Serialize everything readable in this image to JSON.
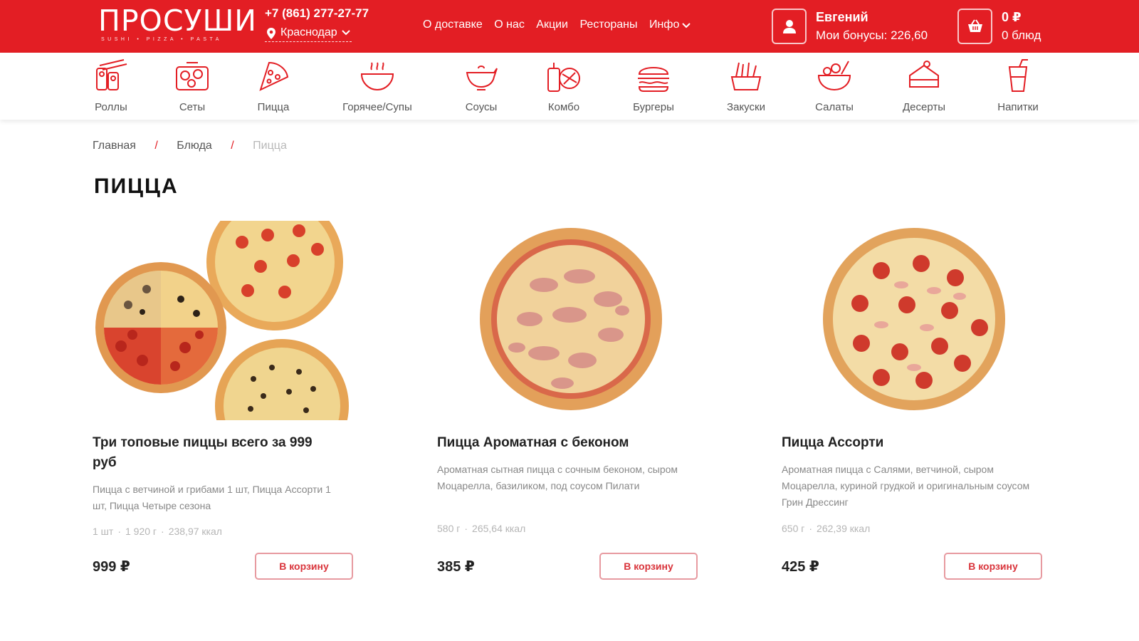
{
  "header": {
    "logo_text": "ПРОСУШИ",
    "logo_tagline": "SUSHI • PIZZA • PASTA",
    "phone": "+7 (861) 277-27-77",
    "city": "Краснодар",
    "nav": [
      "О доставке",
      "О нас",
      "Акции",
      "Рестораны",
      "Инфо"
    ],
    "user_name": "Евгений",
    "user_bonus": "Мои бонусы: 226,60",
    "cart_sum": "0 ₽",
    "cart_count": "0 блюд"
  },
  "categories": [
    "Роллы",
    "Сеты",
    "Пицца",
    "Горячее/Супы",
    "Соусы",
    "Комбо",
    "Бургеры",
    "Закуски",
    "Салаты",
    "Десерты",
    "Напитки"
  ],
  "breadcrumbs": [
    "Главная",
    "Блюда",
    "Пицца"
  ],
  "page_title": "ПИЦЦА",
  "products": [
    {
      "title": "Три топовые пиццы всего за 999 руб",
      "description": "Пицца с ветчиной и грибами 1 шт, Пицца Ассорти 1 шт, Пицца Четыре сезона",
      "meta": [
        "1 шт",
        "1 920 г",
        "238,97 ккал"
      ],
      "price": "999 ₽",
      "button": "В корзину"
    },
    {
      "title": "Пицца Ароматная с беконом",
      "description": "Ароматная сытная пицца с сочным беконом, сыром Моцарелла, базиликом, под соусом Пилати",
      "meta": [
        "580 г",
        "265,64 ккал"
      ],
      "price": "385 ₽",
      "button": "В корзину"
    },
    {
      "title": "Пицца Ассорти",
      "description": "Ароматная пицца с Салями, ветчиной, сыром Моцарелла, куриной грудкой и оригинальным соусом Грин Дрессинг",
      "meta": [
        "650 г",
        "262,39 ккал"
      ],
      "price": "425 ₽",
      "button": "В корзину"
    }
  ],
  "colors": {
    "brand_red": "#e31e24",
    "button_border": "#e79aa0"
  }
}
